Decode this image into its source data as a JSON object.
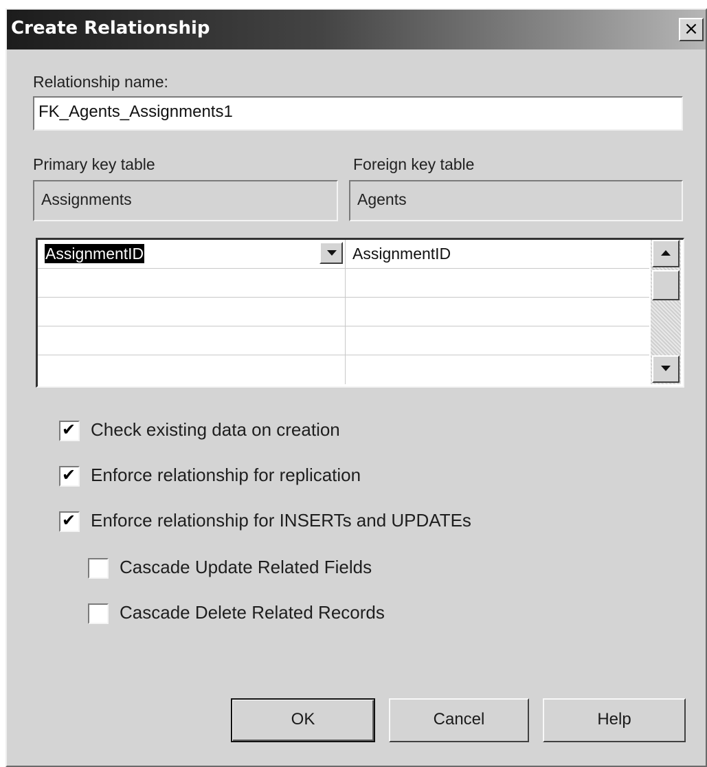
{
  "dialog": {
    "title": "Create Relationship",
    "close_glyph": "×"
  },
  "relationship": {
    "name_label": "Relationship name:",
    "name_value": "FK_Agents_Assignments1"
  },
  "tables": {
    "primary_label": "Primary key table",
    "primary_value": "Assignments",
    "foreign_label": "Foreign key table",
    "foreign_value": "Agents"
  },
  "columns_grid": {
    "rows": [
      {
        "primary": "AssignmentID",
        "foreign": "AssignmentID"
      },
      {
        "primary": "",
        "foreign": ""
      },
      {
        "primary": "",
        "foreign": ""
      },
      {
        "primary": "",
        "foreign": ""
      },
      {
        "primary": "",
        "foreign": ""
      }
    ]
  },
  "options": {
    "check_existing": {
      "label": "Check existing data on creation",
      "checked": true
    },
    "enforce_replication": {
      "label": "Enforce relationship for replication",
      "checked": true
    },
    "enforce_inserts_updates": {
      "label": "Enforce relationship for INSERTs and UPDATEs",
      "checked": true
    },
    "cascade_update": {
      "label": "Cascade Update Related Fields",
      "checked": false
    },
    "cascade_delete": {
      "label": "Cascade Delete Related Records",
      "checked": false
    }
  },
  "buttons": {
    "ok": "OK",
    "cancel": "Cancel",
    "help": "Help"
  },
  "icons": {
    "close": "close-icon",
    "dropdown": "chevron-down-icon",
    "scroll_up": "scroll-up-icon",
    "scroll_down": "scroll-down-icon",
    "check": "checkmark-icon"
  }
}
